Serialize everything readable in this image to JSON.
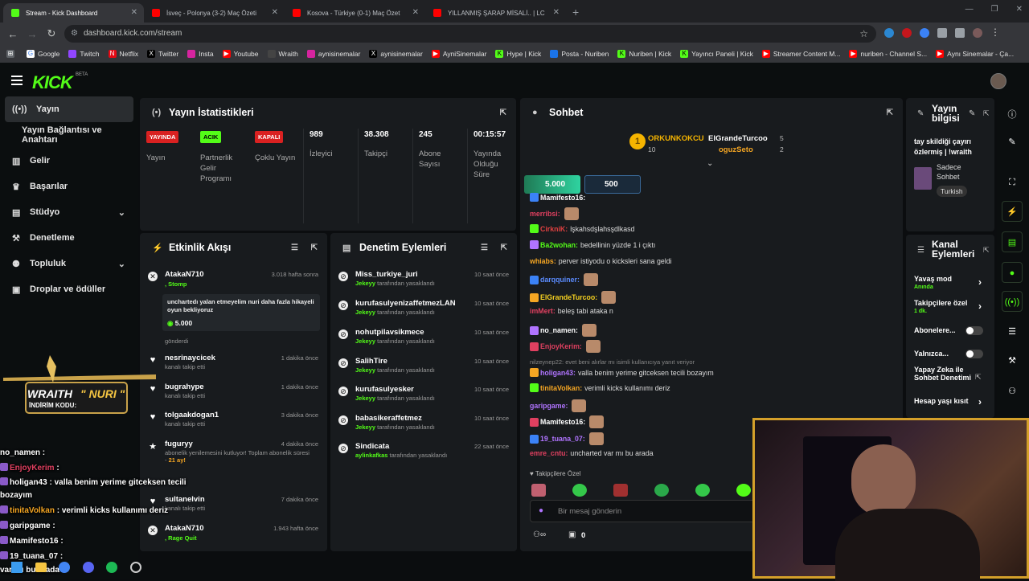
{
  "browser": {
    "tabs": [
      {
        "label": "Stream - Kick Dashboard",
        "active": true,
        "favicon_color": "#53fc18"
      },
      {
        "label": "İsveç - Polonya (3-2) Maç Özeti",
        "active": false,
        "favicon_color": "#ff0000"
      },
      {
        "label": "Kosova - Türkiye (0-1) Maç Özet",
        "active": false,
        "favicon_color": "#ff0000"
      },
      {
        "label": "YILLANMIŞ ŞARAP MİSALİ.. | LC",
        "active": false,
        "favicon_color": "#ff0000"
      }
    ],
    "new_tab": "+",
    "url": "dashboard.kick.com/stream",
    "bookmarks": [
      "Google",
      "Twitch",
      "Netflix",
      "Twitter",
      "Insta",
      "Youtube",
      "Wraith",
      "aynisinemalar",
      "aynisinemalar",
      "AyniSinemalar",
      "Hype | Kick",
      "Posta - Nuriben",
      "Nuriben | Kick",
      "Yayıncı Paneli | Kick",
      "Streamer Content M...",
      "nuriben - Channel S...",
      "Aynı Sinemalar - Ça..."
    ]
  },
  "kick": {
    "logo": "KICK",
    "beta": "BETA"
  },
  "sidebar": {
    "items": [
      {
        "label": "Yayın",
        "icon": "broadcast-icon",
        "active": true
      },
      {
        "label": "Yayın Bağlantısı ve Anahtarı",
        "sub": true
      },
      {
        "label": "Gelir",
        "icon": "revenue-icon"
      },
      {
        "label": "Başarılar",
        "icon": "trophy-icon"
      },
      {
        "label": "Stüdyo",
        "icon": "studio-icon",
        "chevron": true
      },
      {
        "label": "Denetleme",
        "icon": "hammer-icon"
      },
      {
        "label": "Topluluk",
        "icon": "community-icon",
        "chevron": true
      },
      {
        "label": "Droplar ve ödüller",
        "icon": "gift-icon"
      }
    ]
  },
  "stats": {
    "title": "Yayın İstatistikleri",
    "cols": [
      {
        "value": "YAYINDA",
        "label": "Yayın",
        "pill_color": "#d92121"
      },
      {
        "value": "ACIK",
        "label": "Partnerlik Gelir Programı",
        "pill_color": "#53fc18"
      },
      {
        "value": "KAPALI",
        "label": "Çoklu Yayın",
        "pill_color": "#d92121"
      },
      {
        "value": "989",
        "label": "İzleyici"
      },
      {
        "value": "38.308",
        "label": "Takipçi"
      },
      {
        "value": "245",
        "label": "Abone Sayısı"
      },
      {
        "value": "00:15:57",
        "label": "Yayında Olduğu Süre"
      }
    ]
  },
  "activity": {
    "title": "Etkinlik Akışı",
    "items": [
      {
        "name": "AtakaN710",
        "time": "3.018 hafta sonra",
        "tag": "Stomp",
        "message": "unchartedı yalan etmeyelim nuri daha fazla hikayeli oyun bekliyoruz",
        "amount": "5.000",
        "sub": "gönderdi"
      },
      {
        "name": "nesrinaycicek",
        "time": "1 dakika önce",
        "sub": "kanalı takip etti"
      },
      {
        "name": "bugrahype",
        "time": "1 dakika önce",
        "sub": "kanalı takip etti"
      },
      {
        "name": "tolgaakdogan1",
        "time": "3 dakika önce",
        "sub": "kanalı takip etti"
      },
      {
        "name": "fuguryy",
        "time": "4 dakika önce",
        "sub": "abonelik yenilemesini kutluyor! Toplam abonelik süresi",
        "months": "21 ay!"
      },
      {
        "name": "sultanelvin",
        "time": "7 dakika önce",
        "sub": "kanalı takip etti"
      },
      {
        "name": "AtakaN710",
        "time": "1.943 hafta önce",
        "tag": "Rage Quit"
      }
    ]
  },
  "moderation": {
    "title": "Denetim Eylemleri",
    "items": [
      {
        "name": "Miss_turkiye_juri",
        "by": "Jekeyy",
        "suffix": "tarafından yasaklandı",
        "time": "10 saat önce"
      },
      {
        "name": "kurufasulyenizaffetmezLAN",
        "by": "Jekeyy",
        "suffix": "tarafından yasaklandı",
        "time": "10 saat önce"
      },
      {
        "name": "nohutpilavsikmece",
        "by": "Jekeyy",
        "suffix": "tarafından yasaklandı",
        "time": "10 saat önce"
      },
      {
        "name": "SalihTire",
        "by": "Jekeyy",
        "suffix": "tarafından yasaklandı",
        "time": "10 saat önce"
      },
      {
        "name": "kurufasulyesker",
        "by": "Jekeyy",
        "suffix": "tarafından yasaklandı",
        "time": "10 saat önce"
      },
      {
        "name": "babasikeraffetmez",
        "by": "Jekeyy",
        "suffix": "tarafından yasaklandı",
        "time": "10 saat önce"
      },
      {
        "name": "Sindicata",
        "by": "aylinkafkas",
        "suffix": "tarafından yasaklandı",
        "time": "22 saat önce"
      }
    ]
  },
  "chat": {
    "title": "Sohbet",
    "leaders": [
      {
        "rank": "1",
        "name": "ORKUNKOKCU",
        "value": "10"
      },
      {
        "name": "ElGrandeTurcoo",
        "value": "5"
      },
      {
        "name": "oguzSeto",
        "value": "2"
      }
    ],
    "gift_buttons": [
      "5.000",
      "500"
    ],
    "messages": [
      {
        "user": "Mamifesto16:",
        "text": "",
        "color": "#ffffff"
      },
      {
        "user": "merribsi:",
        "text": "",
        "color": "#e04060",
        "emote": true
      },
      {
        "user": "CirkniK:",
        "text": "lşkahsdşlahsşdlkasd",
        "color": "#e04040"
      },
      {
        "user": "Ba2wohan:",
        "text": "bedellinin yüzde 1 i çıktı",
        "color": "#53fc18"
      },
      {
        "user": "whiabs:",
        "text": "perver istiyodu o kicksleri sana geldi",
        "color": "#f5a623"
      },
      {
        "user": "darqquiner:",
        "text": "",
        "color": "#5b8cff",
        "emote": true
      },
      {
        "user": "ElGrandeTurcoo:",
        "text": "",
        "color": "#f5d020",
        "emote": true
      },
      {
        "user": "imMert:",
        "text": "beleş tabi ataka n",
        "color": "#e04060"
      },
      {
        "user": "no_namen:",
        "text": "",
        "color": "#ffffff",
        "emote": true
      },
      {
        "user": "EnjoyKerim:",
        "text": "",
        "color": "#e04060",
        "emote": true
      },
      {
        "user": "nilzeynep22: evet beni alırlar mı isimli kullanıcıya yanıt veriyor",
        "text": "",
        "color": "#888888",
        "reply": true
      },
      {
        "user": "holigan43:",
        "text": "valla benim yerime gitceksen tecili bozayım",
        "color": "#b074ff"
      },
      {
        "user": "tinitaVolkan:",
        "text": "verimli kicks kullanımı deriz",
        "color": "#f5a623"
      },
      {
        "user": "garipgame:",
        "text": "",
        "color": "#b074ff",
        "emote": true
      },
      {
        "user": "Mamifesto16:",
        "text": "",
        "color": "#ffffff",
        "emote": true
      },
      {
        "user": "19_tuana_07:",
        "text": "",
        "color": "#b074ff",
        "emote": true
      },
      {
        "user": "emre_cntu:",
        "text": "uncharted var mı bu arada",
        "color": "#e04060"
      }
    ],
    "followers_only": "Takipçilere Özel",
    "input_placeholder": "Bir mesaj gönderin",
    "counter": "0"
  },
  "stream_info": {
    "title": "Yayın bilgisi",
    "stream_title": "tay skildiği çayırı özlermiş | !wraith",
    "category": "Sadece Sohbet",
    "language": "Turkish"
  },
  "channel_actions": {
    "title": "Kanal Eylemleri",
    "items": [
      {
        "label": "Yavaş mod",
        "sub": "Anında",
        "type": "arrow"
      },
      {
        "label": "Takipçilere özel",
        "sub": "1 dk.",
        "type": "arrow"
      },
      {
        "label": "Abonelere...",
        "type": "toggle"
      },
      {
        "label": "Yalnızca...",
        "type": "toggle"
      },
      {
        "label": "Yapay Zeka ile Sohbet Denetimi",
        "type": "link"
      },
      {
        "label": "Hesap yaşı kısıt",
        "type": "arrow"
      }
    ]
  },
  "overlay": {
    "sponsor_brand": "WRAITH",
    "sponsor_code": "NURI",
    "sponsor_sub": "İNDİRİM KODU:",
    "chat": [
      {
        "user": "no_namen",
        "text": "",
        "color": "#ffffff"
      },
      {
        "user": "EnjoyKerim",
        "text": "",
        "color": "#e04060"
      },
      {
        "user": "holigan43",
        "text": "valla benim yerime gitceksen tecili",
        "color": "#ffffff"
      },
      {
        "user": "",
        "text": "bozayım",
        "color": "#ffffff"
      },
      {
        "user": "tinitaVolkan",
        "text": "verimli kicks kullanımı deriz",
        "color": "#f5a623"
      },
      {
        "user": "garipgame",
        "text": "",
        "color": "#ffffff"
      },
      {
        "user": "Mamifesto16",
        "text": "",
        "color": "#ffffff"
      },
      {
        "user": "19_tuana_07",
        "text": "",
        "color": "#ffffff"
      },
      {
        "user": "",
        "text": "var mı bu arada",
        "color": "#ffffff"
      }
    ]
  }
}
